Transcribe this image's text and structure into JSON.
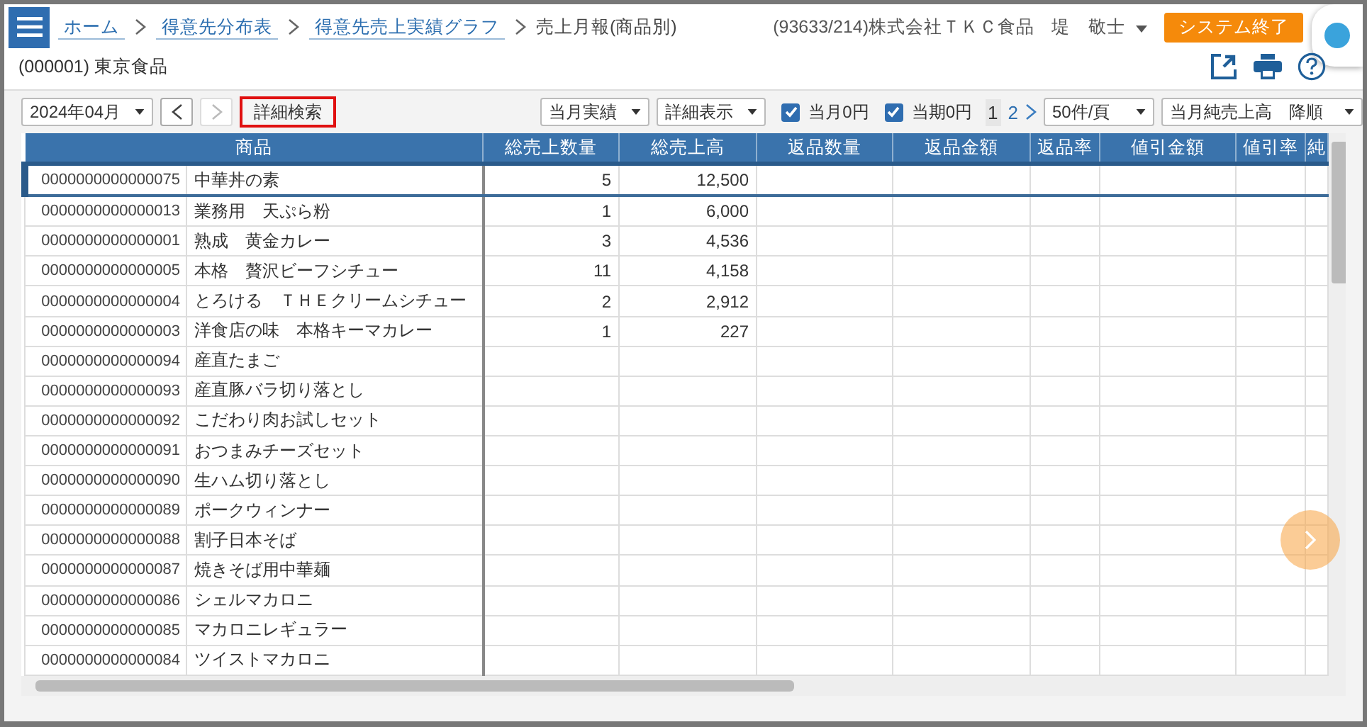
{
  "breadcrumbs": [
    {
      "label": "ホーム",
      "link": true
    },
    {
      "label": "得意先分布表",
      "link": true
    },
    {
      "label": "得意先売上実績グラフ",
      "link": true
    },
    {
      "label": "売上月報(商品別)",
      "link": false
    }
  ],
  "user": {
    "company": "(93633/214)株式会社ＴＫＣ食品",
    "name": "堤　敬士"
  },
  "exit_button": "システム終了",
  "customer": "(000001) 東京食品",
  "toolbar": {
    "month": "2024年04月",
    "search_button": "詳細検索",
    "mode": "当月実績",
    "display": "詳細表示",
    "checks": [
      {
        "label": "当月0円",
        "checked": true
      },
      {
        "label": "当期0円",
        "checked": true
      }
    ],
    "pages": [
      {
        "label": "1",
        "selected": true
      },
      {
        "label": "2",
        "selected": false
      }
    ],
    "page_size": "50件/頁",
    "sort": "当月純売上高　降順"
  },
  "table": {
    "columns": [
      "商品",
      "総売上数量",
      "総売上高",
      "返品数量",
      "返品金額",
      "返品率",
      "値引金額",
      "値引率",
      "純"
    ],
    "rows": [
      {
        "code": "0000000000000075",
        "name": "中華丼の素",
        "qty": "5",
        "sales": "12,500",
        "selected": true
      },
      {
        "code": "0000000000000013",
        "name": "業務用　天ぷら粉",
        "qty": "1",
        "sales": "6,000",
        "selected": false
      },
      {
        "code": "0000000000000001",
        "name": "熟成　黄金カレー",
        "qty": "3",
        "sales": "4,536",
        "selected": false
      },
      {
        "code": "0000000000000005",
        "name": "本格　贅沢ビーフシチュー",
        "qty": "11",
        "sales": "4,158",
        "selected": false
      },
      {
        "code": "0000000000000004",
        "name": "とろける　ＴＨＥクリームシチュー",
        "qty": "2",
        "sales": "2,912",
        "selected": false
      },
      {
        "code": "0000000000000003",
        "name": "洋食店の味　本格キーマカレー",
        "qty": "1",
        "sales": "227",
        "selected": false
      },
      {
        "code": "0000000000000094",
        "name": "産直たまご",
        "selected": false
      },
      {
        "code": "0000000000000093",
        "name": "産直豚バラ切り落とし",
        "selected": false
      },
      {
        "code": "0000000000000092",
        "name": "こだわり肉お試しセット",
        "selected": false
      },
      {
        "code": "0000000000000091",
        "name": "おつまみチーズセット",
        "selected": false
      },
      {
        "code": "0000000000000090",
        "name": "生ハム切り落とし",
        "selected": false
      },
      {
        "code": "0000000000000089",
        "name": "ポークウィンナー",
        "selected": false
      },
      {
        "code": "0000000000000088",
        "name": "割子日本そば",
        "selected": false
      },
      {
        "code": "0000000000000087",
        "name": "焼きそば用中華麺",
        "selected": false
      },
      {
        "code": "0000000000000086",
        "name": "シェルマカロニ",
        "selected": false
      },
      {
        "code": "0000000000000085",
        "name": "マカロニレギュラー",
        "selected": false
      },
      {
        "code": "0000000000000084",
        "name": "ツイストマカロニ",
        "selected": false
      }
    ]
  }
}
